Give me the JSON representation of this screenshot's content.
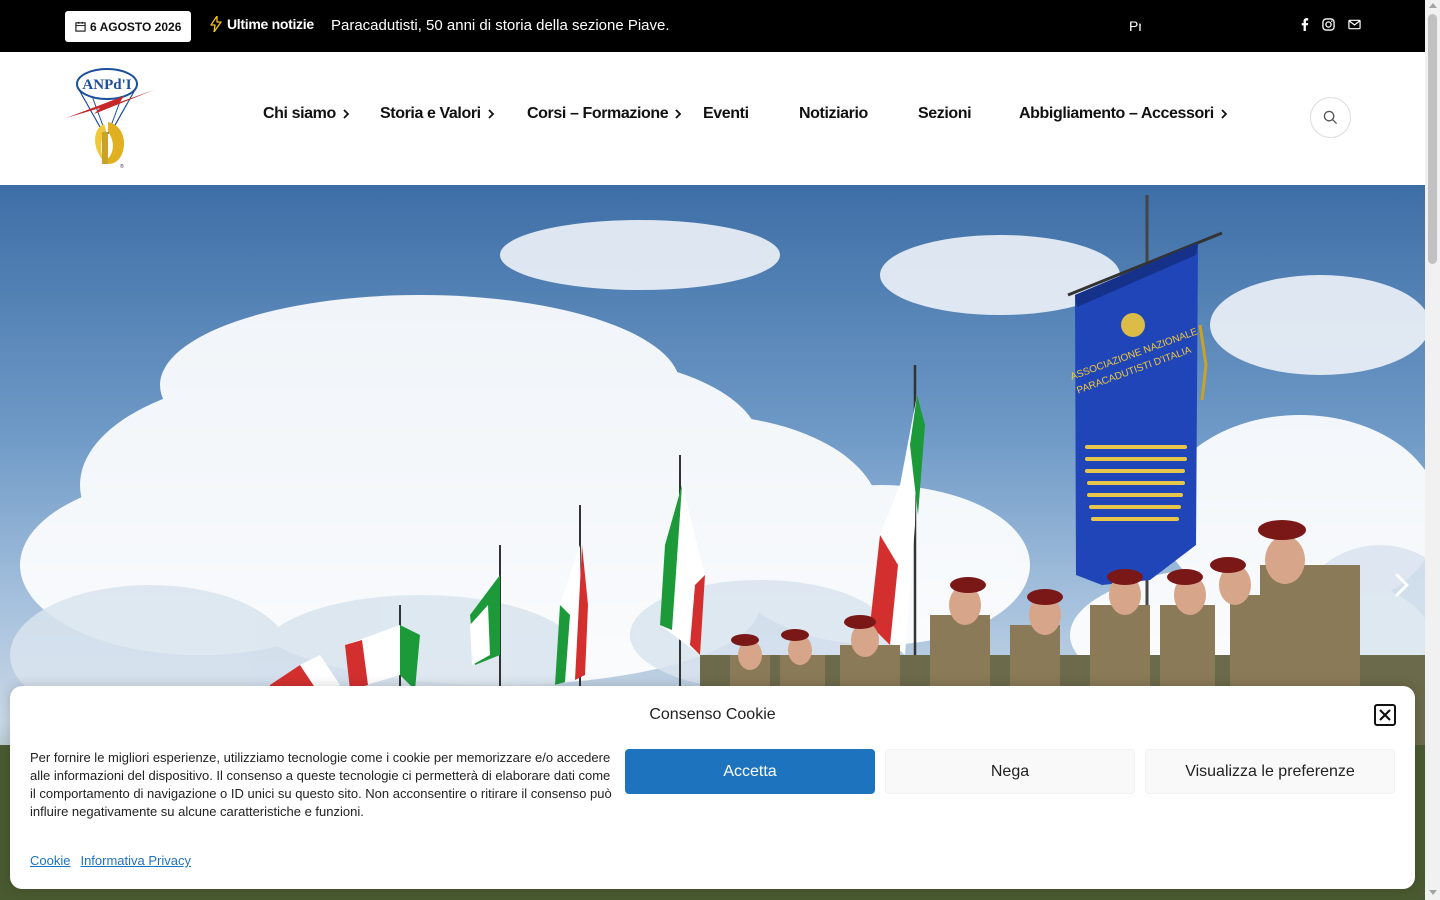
{
  "topbar": {
    "date": "6 AGOSTO 2026",
    "breaking_label": "Ultime notizie",
    "ticker_text": "Paracadutisti, 50 anni di storia della sezione Piave.",
    "ticker_next": "Pr",
    "social": [
      "facebook-icon",
      "instagram-icon",
      "mail-icon"
    ]
  },
  "header": {
    "logo_text": "ANPd'I",
    "nav": [
      {
        "label": "Chi siamo",
        "has_submenu": true
      },
      {
        "label": "Storia e Valori",
        "has_submenu": true
      },
      {
        "label": "Corsi – Formazione",
        "has_submenu": true
      },
      {
        "label": "Eventi",
        "has_submenu": false
      },
      {
        "label": "Notiziario",
        "has_submenu": false
      },
      {
        "label": "Sezioni",
        "has_submenu": false
      },
      {
        "label": "Abbigliamento – Accessori",
        "has_submenu": true
      }
    ]
  },
  "hero": {
    "banner_line1": "ASSOCIAZIONE NAZIONALE",
    "banner_line2": "PARACADUTISTI D'ITALIA"
  },
  "cookie": {
    "title": "Consenso Cookie",
    "text": "Per fornire le migliori esperienze, utilizziamo tecnologie come i cookie per memorizzare e/o accedere alle informazioni del dispositivo. Il consenso a queste tecnologie ci permetterà di elaborare dati come il comportamento di navigazione o ID unici su questo sito. Non acconsentire o ritirare il consenso può influire negativamente su alcune caratteristiche e funzioni.",
    "accept_label": "Accetta",
    "deny_label": "Nega",
    "prefs_label": "Visualizza le preferenze",
    "links": [
      "Cookie",
      "Informativa Privacy"
    ]
  },
  "colors": {
    "accent": "#1e73be",
    "topbar_bg": "#000000"
  }
}
